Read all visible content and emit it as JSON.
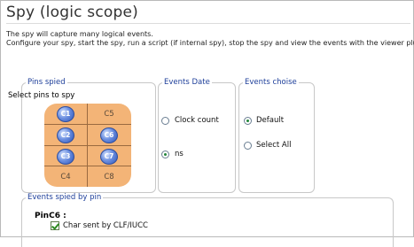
{
  "title": "Spy (logic scope)",
  "description": {
    "line1": "The spy will capture many logical events.",
    "line2": "Configure your spy, start the spy, run a script (if internal spy), stop the spy and view the events with the viewer plugin."
  },
  "pins_spied": {
    "legend": "Pins spied",
    "subtitle": "Select pins to spy",
    "pins": [
      {
        "label": "C1",
        "selected": true
      },
      {
        "label": "C5",
        "selected": false
      },
      {
        "label": "C2",
        "selected": true
      },
      {
        "label": "C6",
        "selected": true
      },
      {
        "label": "C3",
        "selected": true
      },
      {
        "label": "C7",
        "selected": true
      },
      {
        "label": "C4",
        "selected": false
      },
      {
        "label": "C8",
        "selected": false
      }
    ]
  },
  "events_date": {
    "legend": "Events Date",
    "options": [
      {
        "label": "Clock count",
        "checked": false
      },
      {
        "label": "ns",
        "checked": true
      }
    ]
  },
  "events_choise": {
    "legend": "Events choise",
    "options": [
      {
        "label": "Default",
        "checked": true
      },
      {
        "label": "Select All",
        "checked": false
      }
    ]
  },
  "events_spied": {
    "legend": "Events spied by pin",
    "pin_name": "PinC6 :",
    "items": [
      {
        "label": "Char sent by CLF/IUCC",
        "checked": true
      }
    ]
  }
}
